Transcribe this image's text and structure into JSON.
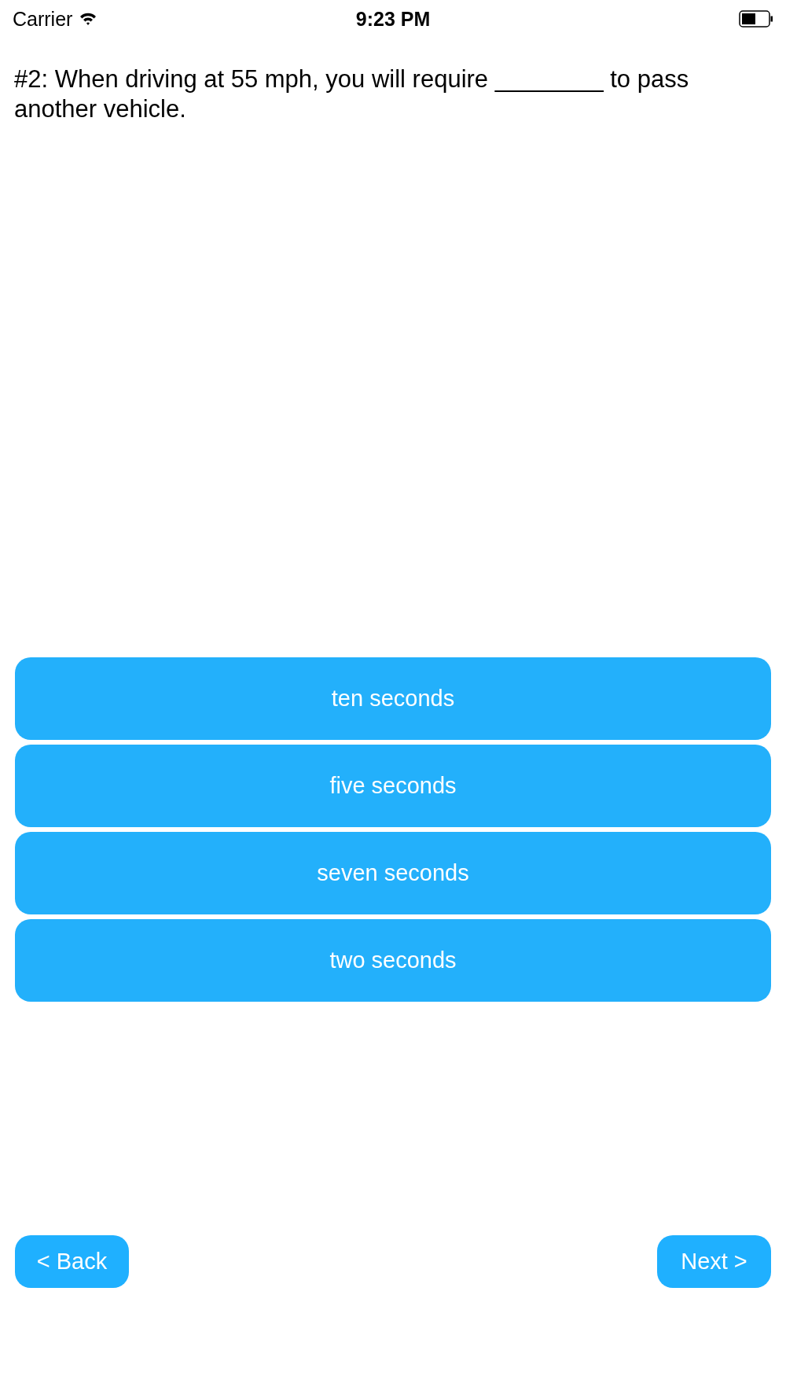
{
  "status_bar": {
    "carrier": "Carrier",
    "time": "9:23 PM"
  },
  "question": "#2: When driving at 55 mph, you will require ________ to pass another vehicle.",
  "answers": [
    {
      "label": "ten seconds"
    },
    {
      "label": "five seconds"
    },
    {
      "label": "seven seconds"
    },
    {
      "label": "two seconds"
    }
  ],
  "nav": {
    "back": "< Back",
    "next": "Next >"
  }
}
